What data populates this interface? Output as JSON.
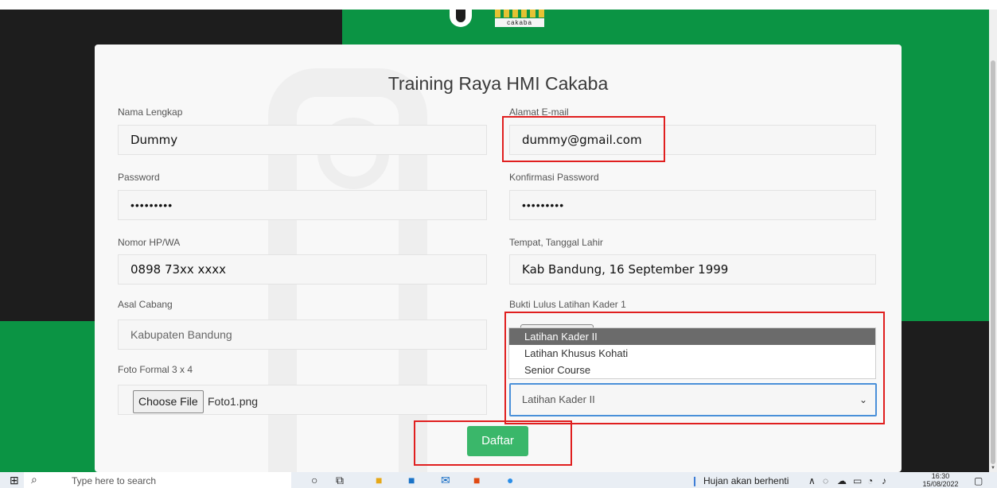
{
  "logo": {
    "text": "cakaba"
  },
  "form": {
    "title": "Training Raya HMI Cakaba",
    "nama_label": "Nama Lengkap",
    "nama_value": "Dummy",
    "email_label": "Alamat E-mail",
    "email_value": "dummy@gmail.com",
    "password_label": "Password",
    "password_value": "•••••••••",
    "konfirmasi_label": "Konfirmasi Password",
    "konfirmasi_value": "•••••••••",
    "hp_label": "Nomor HP/WA",
    "hp_value": "0898 73xx xxxx",
    "ttl_label": "Tempat, Tanggal Lahir",
    "ttl_value": "Kab Bandung, 16 September 1999",
    "cabang_label": "Asal Cabang",
    "cabang_value": "Kabupaten Bandung",
    "foto_label": "Foto Formal 3 x 4",
    "choose_file_label": "Choose File",
    "foto_file": "Foto1.png",
    "bukti_label": "Bukti Lulus Latihan Kader 1",
    "dropdown_options": [
      "Latihan Kader II",
      "Latihan Khusus Kohati",
      "Senior Course"
    ],
    "select_value": "Latihan Kader II",
    "submit_label": "Daftar"
  },
  "taskbar": {
    "search_placeholder": "Type here to search",
    "weather": "Hujan akan berhenti",
    "time": "16:30",
    "date": "15/08/2022"
  },
  "colors": {
    "brand_green": "#0b9444",
    "button_green": "#3ab76a",
    "highlight_red": "#e01f1f",
    "focus_blue": "#4a90d9"
  }
}
